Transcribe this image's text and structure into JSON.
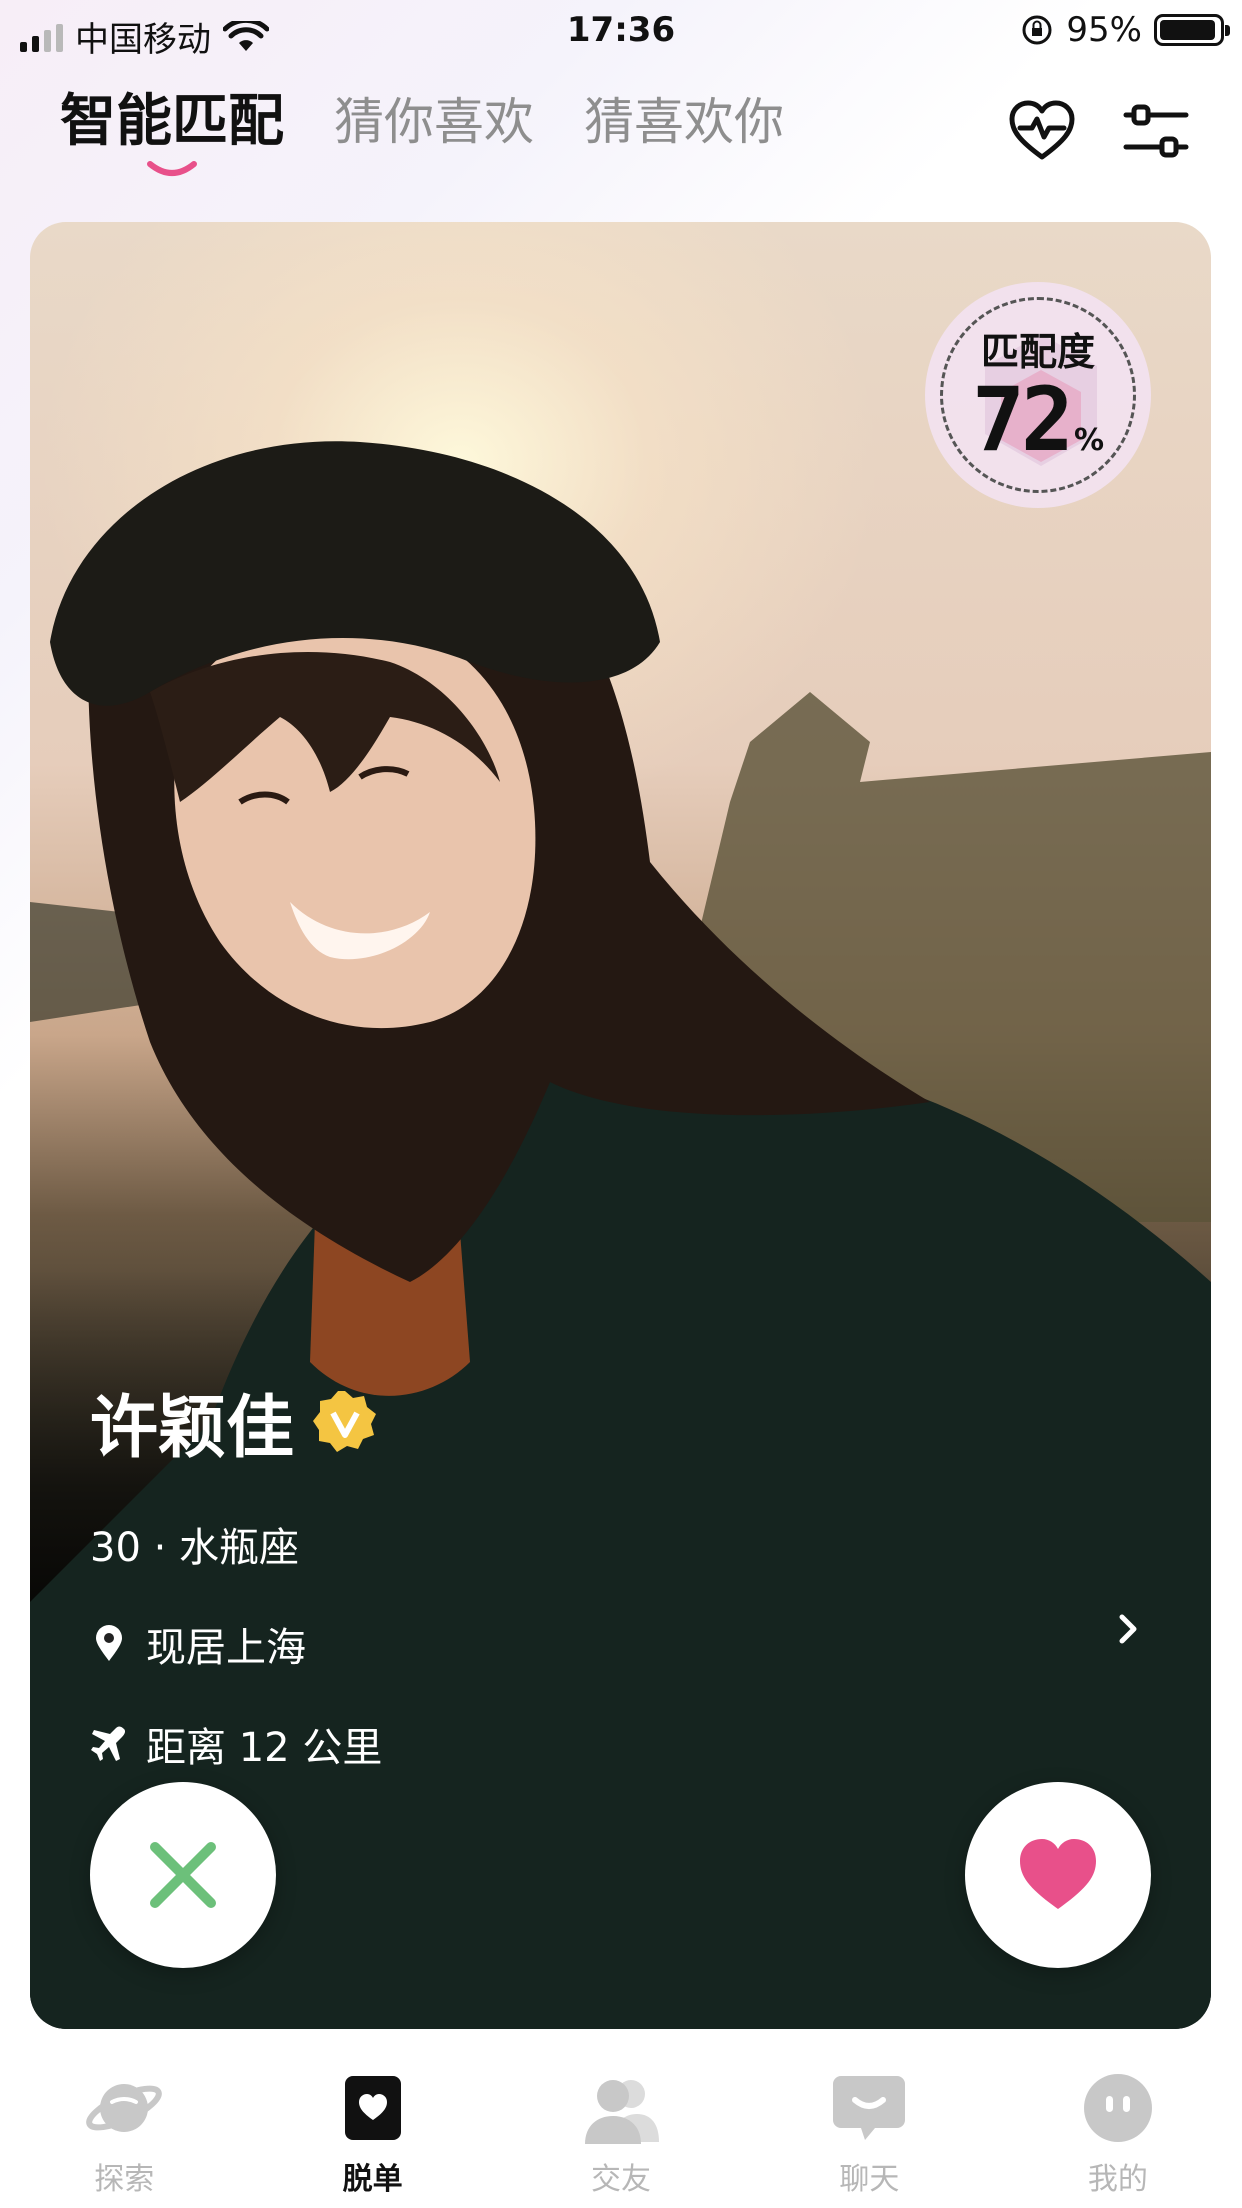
{
  "status_bar": {
    "carrier": "中国移动",
    "time": "17:36",
    "battery": "95%",
    "battery_level": 0.95
  },
  "top_tabs": [
    {
      "label": "智能匹配",
      "active": true
    },
    {
      "label": "猜你喜欢",
      "active": false
    },
    {
      "label": "猜喜欢你",
      "active": false
    }
  ],
  "top_icons": [
    "heart-pulse-icon",
    "filter-sliders-icon"
  ],
  "colors": {
    "accent_pink": "#e8508a",
    "dislike_green": "#6cc07a",
    "verified_gold": "#f4c542"
  },
  "card": {
    "match": {
      "label": "匹配度",
      "value": "72",
      "unit": "%"
    },
    "profile": {
      "name": "许颖佳",
      "meta": "30 · 水瓶座",
      "location": "现居上海",
      "distance": "距离 12 公里"
    }
  },
  "bottom_nav": [
    {
      "label": "探索",
      "icon": "planet-icon",
      "active": false
    },
    {
      "label": "脱单",
      "icon": "heart-card-icon",
      "active": true
    },
    {
      "label": "交友",
      "icon": "friends-icon",
      "active": false
    },
    {
      "label": "聊天",
      "icon": "chat-bubble-icon",
      "active": false
    },
    {
      "label": "我的",
      "icon": "profile-face-icon",
      "active": false
    }
  ]
}
